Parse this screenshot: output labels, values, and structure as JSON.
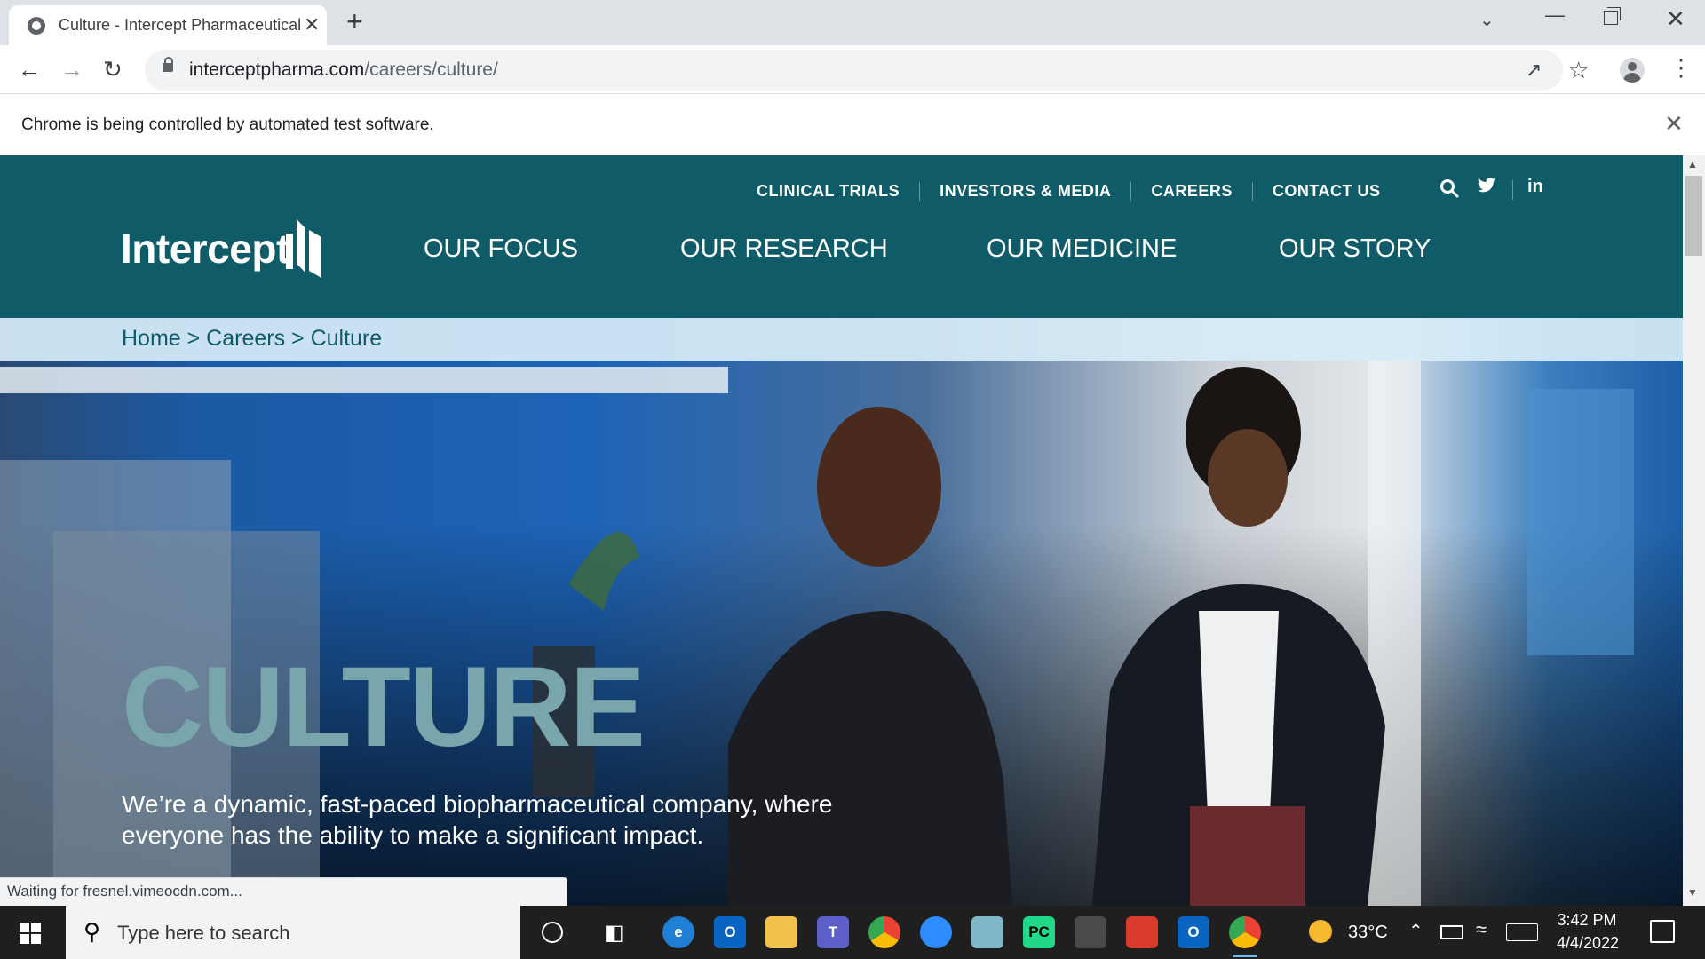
{
  "browser": {
    "tab_title": "Culture - Intercept Pharmaceutical",
    "tab_close": "✕",
    "new_tab": "+",
    "url_host": "interceptpharma.com",
    "url_path": "/careers/culture/",
    "infobar_text": "Chrome is being controlled by automated test software.",
    "status_text": "Waiting for fresnel.vimeocdn.com..."
  },
  "site": {
    "utility_nav": [
      "CLINICAL TRIALS",
      "INVESTORS & MEDIA",
      "CAREERS",
      "CONTACT US"
    ],
    "linkedin_label": "in",
    "logo_text": "Intercept",
    "main_nav": [
      "OUR FOCUS",
      "OUR RESEARCH",
      "OUR MEDICINE",
      "OUR STORY"
    ],
    "breadcrumb": "Home > Careers > Culture",
    "hero_title": "CULTURE",
    "hero_subtitle": "We’re a dynamic, fast-paced biopharmaceutical company, where everyone has the ability to make a significant impact."
  },
  "taskbar": {
    "search_placeholder": "Type here to search",
    "weather": "33°C",
    "time": "3:42 PM",
    "date": "4/4/2022",
    "apps": [
      "edge-icon",
      "outlook-icon",
      "file-explorer-icon",
      "teams-icon",
      "chrome-icon",
      "zoom-icon",
      "notepad-icon",
      "pycharm-icon",
      "calculator-icon",
      "paint-icon",
      "outlook-icon-2",
      "chrome-icon-active"
    ]
  },
  "colors": {
    "brand_teal": "#0f5c68",
    "hero_title": "#79a5ad",
    "breadcrumb_bar": "#d6ecf7"
  }
}
